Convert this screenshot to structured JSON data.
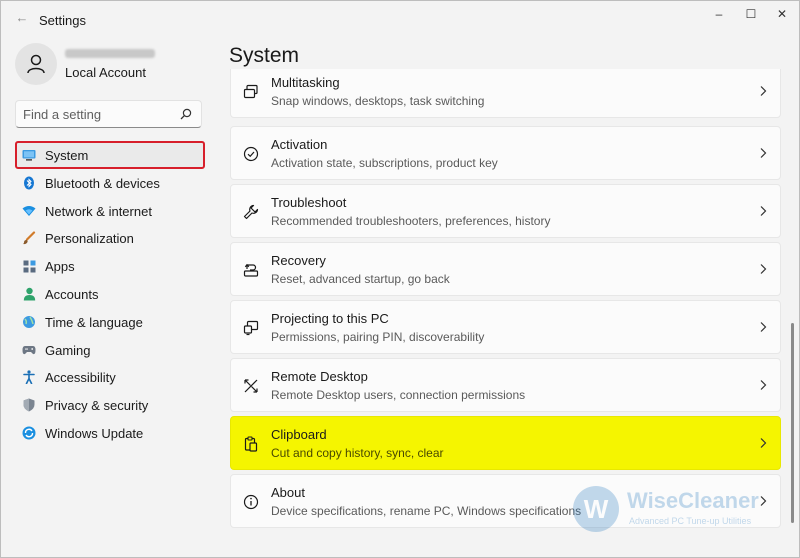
{
  "window": {
    "back_glyph": "←",
    "title": "Settings",
    "controls": {
      "minimize": "–",
      "maximize": "☐",
      "close": "✕"
    }
  },
  "profile": {
    "account_type": "Local Account"
  },
  "search": {
    "placeholder": "Find a setting"
  },
  "sidebar": {
    "items": [
      {
        "label": "System",
        "icon": "system-icon",
        "selected": true
      },
      {
        "label": "Bluetooth & devices",
        "icon": "bluetooth-icon"
      },
      {
        "label": "Network & internet",
        "icon": "network-icon"
      },
      {
        "label": "Personalization",
        "icon": "personalization-icon"
      },
      {
        "label": "Apps",
        "icon": "apps-icon"
      },
      {
        "label": "Accounts",
        "icon": "accounts-icon"
      },
      {
        "label": "Time & language",
        "icon": "time-language-icon"
      },
      {
        "label": "Gaming",
        "icon": "gaming-icon"
      },
      {
        "label": "Accessibility",
        "icon": "accessibility-icon"
      },
      {
        "label": "Privacy & security",
        "icon": "privacy-icon"
      },
      {
        "label": "Windows Update",
        "icon": "windows-update-icon"
      }
    ]
  },
  "main": {
    "title": "System",
    "cards": [
      {
        "title": "Multitasking",
        "desc": "Snap windows, desktops, task switching",
        "icon": "multitasking-icon"
      },
      {
        "title": "Activation",
        "desc": "Activation state, subscriptions, product key",
        "icon": "activation-icon"
      },
      {
        "title": "Troubleshoot",
        "desc": "Recommended troubleshooters, preferences, history",
        "icon": "troubleshoot-icon"
      },
      {
        "title": "Recovery",
        "desc": "Reset, advanced startup, go back",
        "icon": "recovery-icon"
      },
      {
        "title": "Projecting to this PC",
        "desc": "Permissions, pairing PIN, discoverability",
        "icon": "projecting-icon"
      },
      {
        "title": "Remote Desktop",
        "desc": "Remote Desktop users, connection permissions",
        "icon": "remote-desktop-icon"
      },
      {
        "title": "Clipboard",
        "desc": "Cut and copy history, sync, clear",
        "icon": "clipboard-icon",
        "highlighted": true
      },
      {
        "title": "About",
        "desc": "Device specifications, rename PC, Windows specifications",
        "icon": "about-icon"
      }
    ]
  },
  "watermark": {
    "logo_letter": "W",
    "name": "WiseCleaner",
    "tagline": "Advanced PC Tune-up Utilities"
  },
  "colors": {
    "accent": "#0067c0",
    "selection_border": "#d71f2b",
    "highlight": "#f5f500"
  }
}
